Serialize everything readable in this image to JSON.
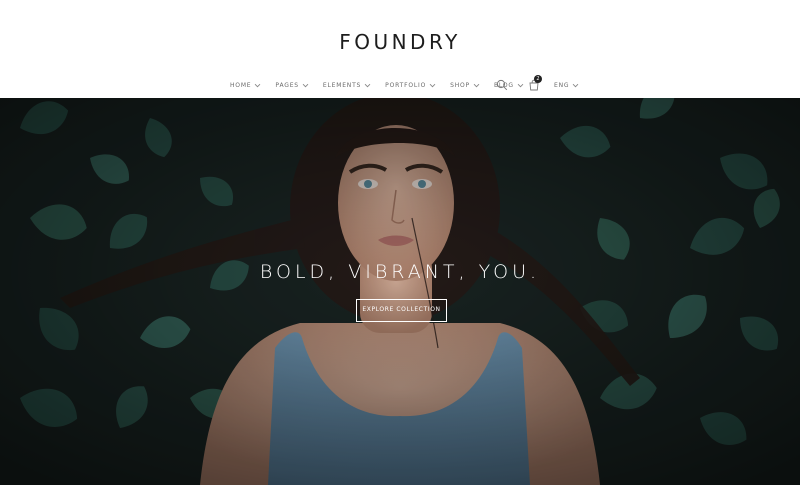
{
  "brand": {
    "logo": "FOUNDRY"
  },
  "nav": {
    "items": [
      {
        "label": "HOME"
      },
      {
        "label": "PAGES"
      },
      {
        "label": "ELEMENTS"
      },
      {
        "label": "PORTFOLIO"
      },
      {
        "label": "SHOP"
      },
      {
        "label": "BLOG"
      }
    ],
    "cart_count": "2",
    "language": "ENG"
  },
  "hero": {
    "title": "BOLD, VIBRANT, YOU.",
    "cta_label": "EXPLORE COLLECTION"
  },
  "icons": {
    "search": "search-icon",
    "cart": "cart-icon",
    "dropdown": "chevron-down-icon"
  },
  "colors": {
    "logo_text": "#1d1d1d",
    "nav_text": "#6a6a6a",
    "hero_leaves": "#2f5a52",
    "hero_dark": "#1f2a29",
    "dress": "#6f9ab8",
    "skin": "#d8ab93",
    "hair": "#2a1e1a"
  }
}
